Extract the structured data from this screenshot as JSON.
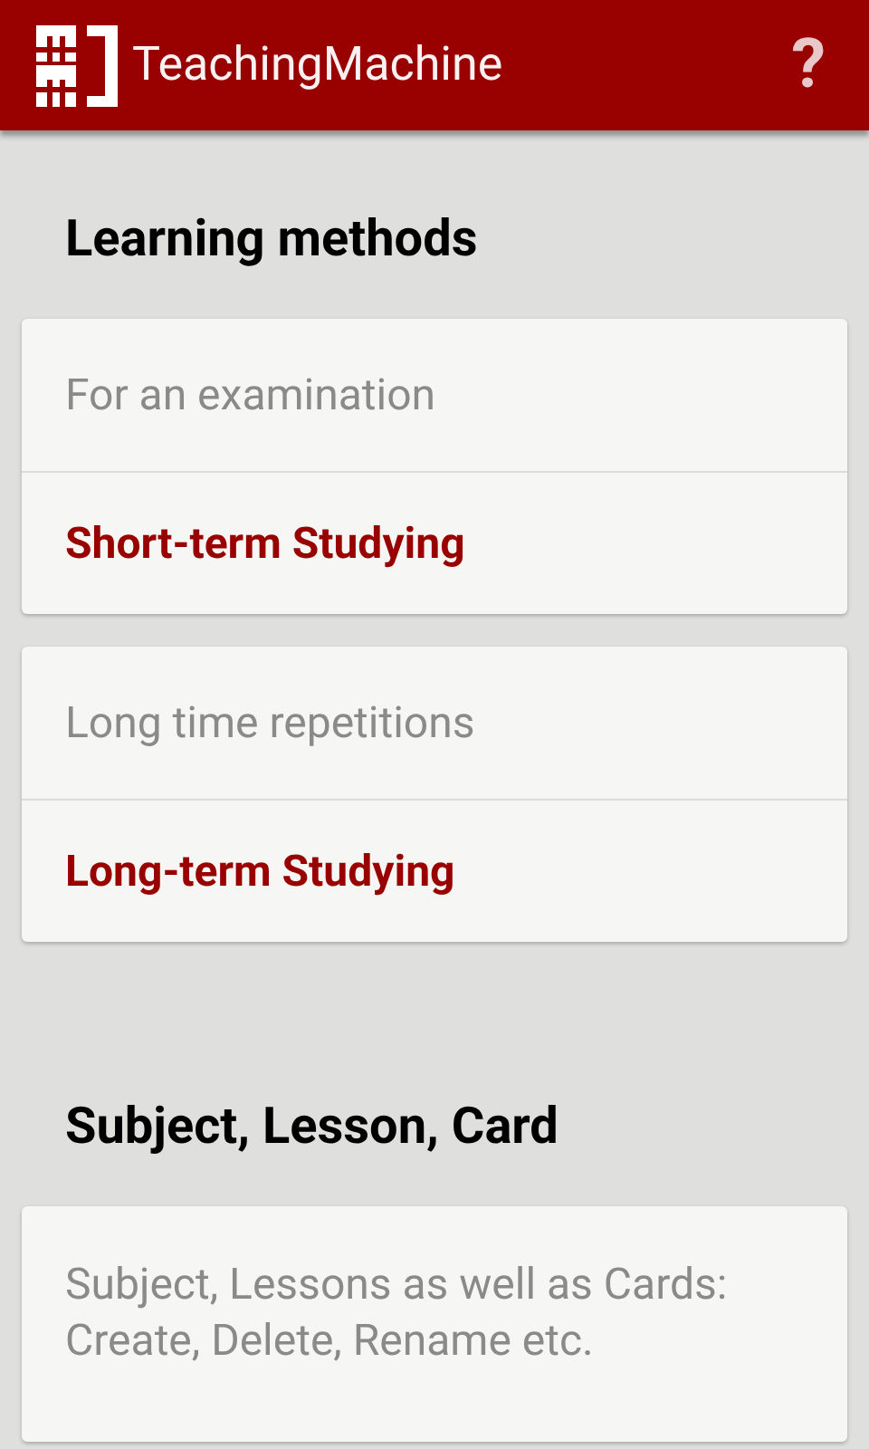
{
  "app_bar": {
    "title": "TeachingMachine",
    "help": "?"
  },
  "sections": [
    {
      "heading": "Learning methods",
      "cards": [
        {
          "description": "For an examination",
          "action": "Short-term Studying"
        },
        {
          "description": "Long time repetitions",
          "action": "Long-term Studying"
        }
      ]
    },
    {
      "heading": "Subject, Lesson, Card",
      "cards": [
        {
          "description": "Subject, Lessons as well as Cards: Create, Delete, Rename etc."
        }
      ]
    }
  ]
}
